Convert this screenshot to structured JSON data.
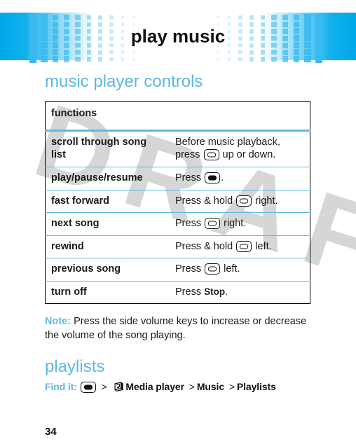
{
  "banner": {
    "title": "play music",
    "gradient_start": "#00a8ea",
    "square_color": "#3cb9ef"
  },
  "accent_color": "#5cb8e6",
  "watermark": {
    "text": "DRAFT"
  },
  "sections": {
    "controls_heading": "music player controls",
    "playlists_heading": "playlists"
  },
  "table": {
    "header": {
      "functions": "functions",
      "blank": ""
    },
    "rows": [
      {
        "function": "scroll through song list",
        "desc_pre": "Before music playback, press ",
        "icon": "navigation-key-icon",
        "desc_post": " up or down."
      },
      {
        "function": "play/pause/resume",
        "desc_pre": "Press ",
        "icon": "center-select-key-icon",
        "desc_post": "."
      },
      {
        "function": "fast forward",
        "desc_pre": "Press & hold ",
        "icon": "navigation-key-icon",
        "desc_post": " right."
      },
      {
        "function": "next song",
        "desc_pre": "Press ",
        "icon": "navigation-key-icon",
        "desc_post": " right."
      },
      {
        "function": "rewind",
        "desc_pre": "Press & hold ",
        "icon": "navigation-key-icon",
        "desc_post": " left."
      },
      {
        "function": "previous song",
        "desc_pre": "Press ",
        "icon": "navigation-key-icon",
        "desc_post": " left."
      },
      {
        "function": "turn off",
        "desc_pre": "Press ",
        "icon": "",
        "desc_bold": "Stop",
        "desc_post": "."
      }
    ]
  },
  "note": {
    "label": "Note:",
    "text": " Press the side volume keys to increase or decrease the volume of the song playing."
  },
  "find_it": {
    "label": "Find it:",
    "icon": "center-select-key-icon",
    "sep1": ">",
    "media_icon": "media-player-icon",
    "item1": "Media player",
    "sep2": ">",
    "item2": "Music",
    "sep3": ">",
    "item3": "Playlists"
  },
  "footer": {
    "page_number": "34"
  }
}
